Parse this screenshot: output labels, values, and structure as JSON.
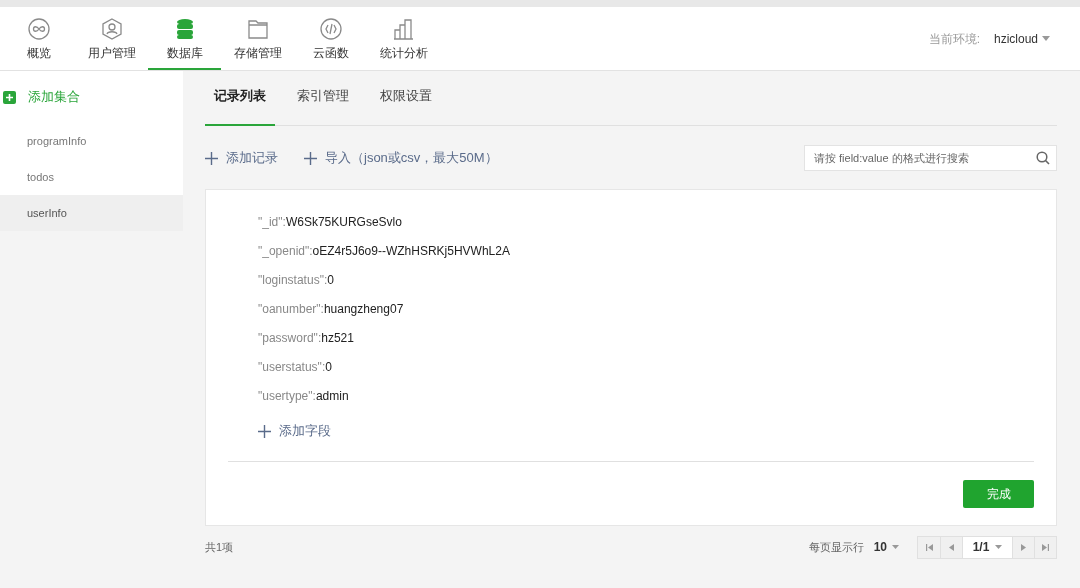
{
  "nav": {
    "items": [
      {
        "label": "概览",
        "selected": false
      },
      {
        "label": "用户管理",
        "selected": false
      },
      {
        "label": "数据库",
        "selected": true
      },
      {
        "label": "存储管理",
        "selected": false
      },
      {
        "label": "云函数",
        "selected": false
      },
      {
        "label": "统计分析",
        "selected": false
      }
    ],
    "env_label": "当前环境:",
    "env_value": "hzicloud"
  },
  "sidebar": {
    "add_label": "添加集合",
    "items": [
      {
        "label": "programInfo",
        "selected": false
      },
      {
        "label": "todos",
        "selected": false
      },
      {
        "label": "userInfo",
        "selected": true
      }
    ]
  },
  "tabs": [
    {
      "label": "记录列表",
      "selected": true
    },
    {
      "label": "索引管理",
      "selected": false
    },
    {
      "label": "权限设置",
      "selected": false
    }
  ],
  "toolbar": {
    "add_record": "添加记录",
    "import": "导入（json或csv，最大50M）",
    "search_placeholder": "请按 field:value 的格式进行搜索"
  },
  "record": {
    "fields": [
      {
        "key": "\"_id\":",
        "value": "W6Sk75KURGseSvlo"
      },
      {
        "key": "\"_openid\":",
        "value": "oEZ4r5J6o9--WZhHSRKj5HVWhL2A"
      },
      {
        "key": "\"loginstatus\":",
        "value": "0"
      },
      {
        "key": "\"oanumber\":",
        "value": "huangzheng07"
      },
      {
        "key": "\"password\":",
        "value": "hz521"
      },
      {
        "key": "\"userstatus\":",
        "value": "0"
      },
      {
        "key": "\"usertype\":",
        "value": "admin"
      }
    ],
    "add_field": "添加字段",
    "done_button": "完成"
  },
  "footer": {
    "total": "共1项",
    "per_page_label": "每页显示行",
    "per_page": "10",
    "page": "1/1"
  }
}
